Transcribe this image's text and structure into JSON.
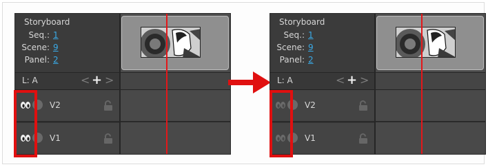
{
  "storyboard": {
    "title": "Storyboard",
    "seq_label": "Seq.:",
    "seq_value": "1",
    "scene_label": "Scene:",
    "scene_value": "9",
    "panel_label": "Panel:",
    "panel_value": "2"
  },
  "layer": {
    "label": "L: A",
    "prev_icon": "<",
    "add_icon": "+",
    "next_icon": ">"
  },
  "tracks": [
    {
      "name": "V2"
    },
    {
      "name": "V1"
    }
  ],
  "colors": {
    "highlight": "#e01010",
    "playhead": "#e4171a",
    "link": "#3aa9e6"
  },
  "icons": {
    "visibility_before": "eye-open-icon",
    "visibility_after": "eye-closed-icon",
    "lock": "lock-icon",
    "arrow": "right-arrow-icon"
  }
}
